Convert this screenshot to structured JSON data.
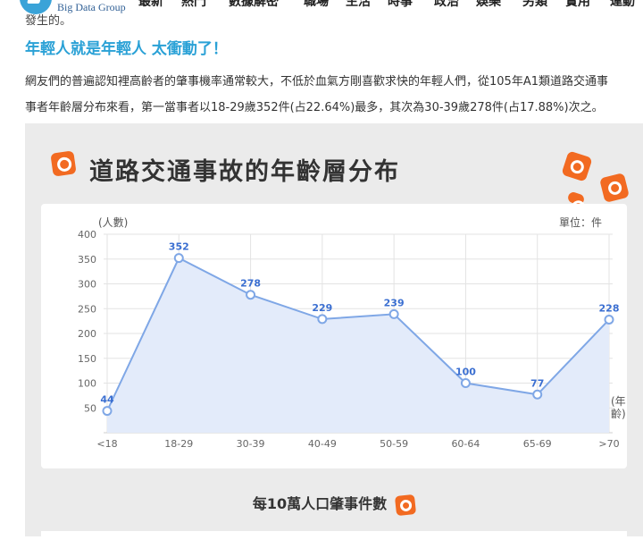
{
  "site": {
    "brand": "Big Data Group",
    "nav": [
      "最新",
      "熱門",
      "數據解密",
      "職場",
      "生活",
      "時事",
      "政治",
      "娛樂",
      "另類",
      "實用",
      "運動"
    ],
    "prev_text": "發生的。"
  },
  "article": {
    "headline": "年輕人就是年輕人 太衝動了！",
    "para1": "網友們的普遍認知裡高齡者的肇事機率通常較大，不低於血氣方剛喜歡求快的年輕人們，從105年A1類道路交通事",
    "para2": "事者年齡層分布來看，第一當事者以18-29歲352件(占22.64%)最多，其次為30-39歲278件(占17.88%)次之。"
  },
  "chart_panel": {
    "title": "道路交通事故的年齡層分布",
    "y_unit": "(人數)",
    "unit_label": "單位：件",
    "x_unit": "(年齡)",
    "sub_title": "每10萬人口肇事件數"
  },
  "chart_data": {
    "type": "area",
    "title": "道路交通事故的年齡層分布",
    "ylabel": "(人數)",
    "xlabel": "(年齡)",
    "unit": "單位：件",
    "categories": [
      "<18",
      "18-29",
      "30-39",
      "40-49",
      "50-59",
      "60-64",
      "65-69",
      ">70"
    ],
    "values": [
      44,
      352,
      278,
      229,
      239,
      100,
      77,
      228
    ],
    "yticks": [
      50,
      100,
      150,
      200,
      250,
      300,
      350,
      400
    ],
    "ylim": [
      0,
      400
    ],
    "grid": true,
    "line_color": "#7fa7e6",
    "fill_color": "#e3ebfa",
    "label_color": "#3b6fd1"
  }
}
